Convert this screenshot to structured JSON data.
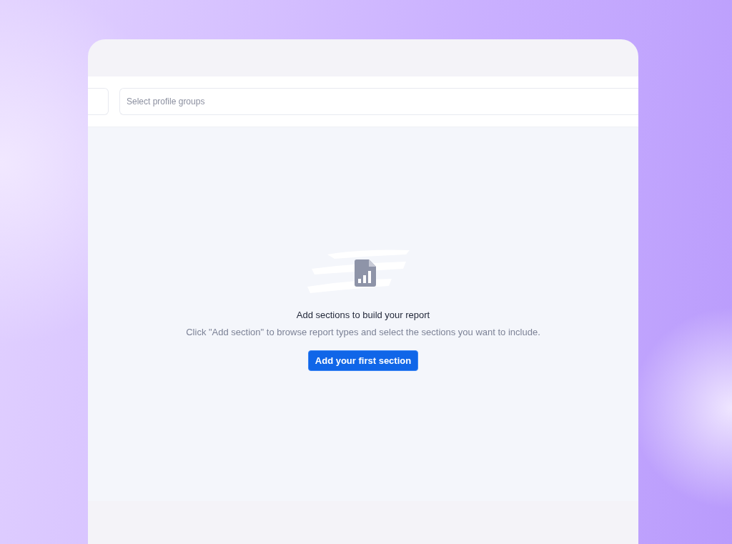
{
  "filters": {
    "profile_groups": {
      "placeholder": "Select profile groups"
    }
  },
  "empty_state": {
    "title": "Add sections to build your report",
    "description": "Click \"Add section\" to browse report types and select the sections you want to include.",
    "button": "Add your first section"
  }
}
